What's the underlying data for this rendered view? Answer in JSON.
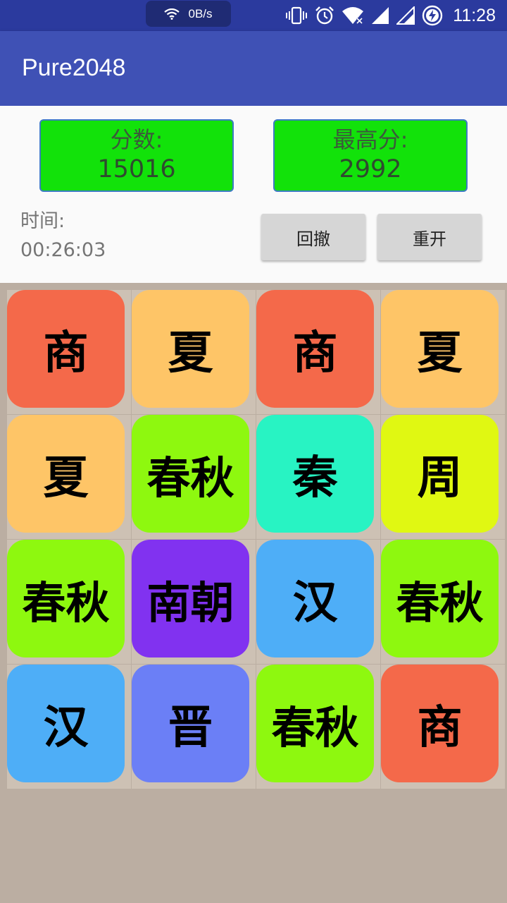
{
  "status_bar": {
    "net_speed": "0B/s",
    "time": "11:28",
    "icons": [
      "wifi-icon",
      "vibrate-icon",
      "alarm-icon",
      "wifi-signal-icon",
      "cell-signal-icon",
      "cell-signal-icon",
      "battery-charging-icon"
    ]
  },
  "app_bar": {
    "title": "Pure2048"
  },
  "score": {
    "label": "分数:",
    "value": "15016"
  },
  "best": {
    "label": "最高分:",
    "value": "2992"
  },
  "time": {
    "label": "时间:",
    "value": "00:26:03"
  },
  "buttons": {
    "undo": "回撤",
    "restart": "重开"
  },
  "colors": {
    "status_bar": "#2b3a9e",
    "app_bar": "#3f51b5",
    "score_box": "#12e20a",
    "board": "#bbaea2"
  },
  "board": {
    "rows": [
      [
        {
          "text": "商",
          "color": "#f4694a"
        },
        {
          "text": "夏",
          "color": "#fec567"
        },
        {
          "text": "商",
          "color": "#f4694a"
        },
        {
          "text": "夏",
          "color": "#fec567"
        }
      ],
      [
        {
          "text": "夏",
          "color": "#fec567"
        },
        {
          "text": "春秋",
          "color": "#8ef80f"
        },
        {
          "text": "秦",
          "color": "#28f3c3"
        },
        {
          "text": "周",
          "color": "#e0f812"
        }
      ],
      [
        {
          "text": "春秋",
          "color": "#8ef80f"
        },
        {
          "text": "南朝",
          "color": "#8132f0"
        },
        {
          "text": "汉",
          "color": "#4eaef7"
        },
        {
          "text": "春秋",
          "color": "#8ef80f"
        }
      ],
      [
        {
          "text": "汉",
          "color": "#4eaef7"
        },
        {
          "text": "晋",
          "color": "#6b7ff6"
        },
        {
          "text": "春秋",
          "color": "#8ef80f"
        },
        {
          "text": "商",
          "color": "#f4694a"
        }
      ]
    ]
  }
}
